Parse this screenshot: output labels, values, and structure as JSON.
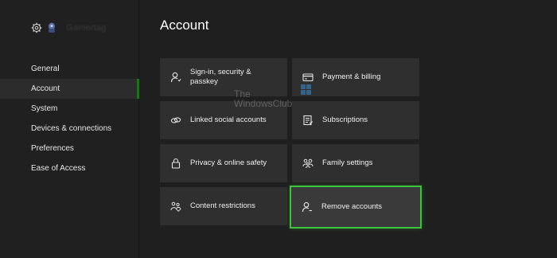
{
  "sidebar": {
    "gamertag": "Gamertag",
    "items": [
      {
        "label": "General"
      },
      {
        "label": "Account"
      },
      {
        "label": "System"
      },
      {
        "label": "Devices & connections"
      },
      {
        "label": "Preferences"
      },
      {
        "label": "Ease of Access"
      }
    ],
    "active_index": 1
  },
  "main": {
    "title": "Account",
    "tiles": [
      {
        "label": "Sign-in, security & passkey",
        "icon": "person-icon"
      },
      {
        "label": "Payment & billing",
        "icon": "credit-card-icon"
      },
      {
        "label": "Linked social accounts",
        "icon": "link-icon"
      },
      {
        "label": "Subscriptions",
        "icon": "document-icon"
      },
      {
        "label": "Privacy & online safety",
        "icon": "lock-icon"
      },
      {
        "label": "Family settings",
        "icon": "family-icon"
      },
      {
        "label": "Content restrictions",
        "icon": "family-restriction-icon"
      },
      {
        "label": "Remove accounts",
        "icon": "person-remove-icon"
      }
    ],
    "focused_tile": "Remove accounts"
  },
  "watermark": {
    "line1": "The",
    "line2": "WindowsClub"
  },
  "colors": {
    "background": "#1f1f1f",
    "tile": "#2f2f2f",
    "accent_green": "#107c10",
    "focus_ring": "#3dc43d"
  }
}
